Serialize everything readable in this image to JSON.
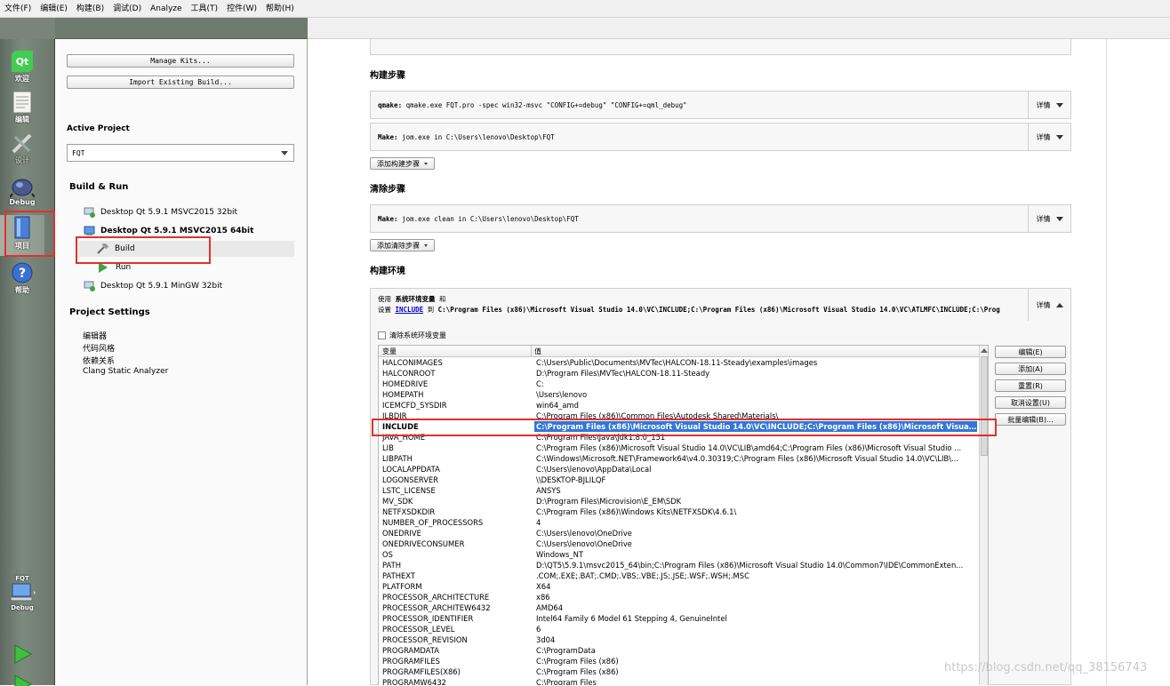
{
  "menu": [
    "文件(F)",
    "编辑(E)",
    "构建(B)",
    "调试(D)",
    "Analyze",
    "工具(T)",
    "控件(W)",
    "帮助(H)"
  ],
  "modes": [
    {
      "name": "welcome",
      "label": "欢迎",
      "icon": "qt-logo-icon"
    },
    {
      "name": "edit",
      "label": "编辑",
      "icon": "document-icon"
    },
    {
      "name": "design",
      "label": "设计",
      "icon": "pen-ruler-icon"
    },
    {
      "name": "debug",
      "label": "Debug",
      "icon": "bug-icon"
    },
    {
      "name": "projects",
      "label": "项目",
      "icon": "book-icon"
    },
    {
      "name": "help",
      "label": "帮助",
      "icon": "help-icon"
    }
  ],
  "target": {
    "project": "FQT",
    "config": "Debug"
  },
  "left": {
    "manage_kits": "Manage Kits...",
    "import_build": "Import Existing Build...",
    "active_project_title": "Active Project",
    "active_project_value": "FQT",
    "build_run_title": "Build & Run",
    "kits": [
      {
        "label": "Desktop Qt 5.9.1 MSVC2015 32bit"
      },
      {
        "label": "Desktop Qt 5.9.1 MSVC2015 64bit"
      },
      {
        "label": "Build"
      },
      {
        "label": "Run"
      },
      {
        "label": "Desktop Qt 5.9.1 MinGW 32bit"
      }
    ],
    "settings_title": "Project Settings",
    "settings": [
      "编辑器",
      "代码风格",
      "依赖关系",
      "Clang Static Analyzer"
    ]
  },
  "main": {
    "build_steps_title": "构建步骤",
    "qmake_label": "qmake:",
    "qmake_cmd": "qmake.exe FQT.pro -spec win32-msvc \"CONFIG+=debug\" \"CONFIG+=qml_debug\"",
    "make_label": "Make:",
    "make_cmd": "jom.exe in C:\\Users\\lenovo\\Desktop\\FQT",
    "details": "详情",
    "add_build_step": "添加构建步骤",
    "clean_steps_title": "清除步骤",
    "clean_cmd": "jom.exe clean in C:\\Users\\lenovo\\Desktop\\FQT",
    "add_clean_step": "添加清除步骤",
    "env_title": "构建环境",
    "env_line1_a": "使用",
    "env_line1_b": "系统环境变量",
    "env_line1_c": "和",
    "env_line2_a": "设置",
    "env_line2_var": "INCLUDE",
    "env_line2_b": "到",
    "env_line2_val": "C:\\Program Files (x86)\\Microsoft Visual Studio 14.0\\VC\\INCLUDE;C:\\Program Files (x86)\\Microsoft Visual Studio 14.0\\VC\\ATLMFC\\INCLUDE;C:\\Prog",
    "clear_sys_env": "清除系统环境变量",
    "col_var": "变量",
    "col_val": "值",
    "buttons": [
      "编辑(E)",
      "添加(A)",
      "重置(R)",
      "取消设置(U)",
      "批量编辑(B)..."
    ],
    "rows": [
      {
        "k": "HALCONIMAGES",
        "v": "C:\\Users\\Public\\Documents\\MVTec\\HALCON-18.11-Steady\\examples\\images"
      },
      {
        "k": "HALCONROOT",
        "v": "D:\\Program Files\\MVTec\\HALCON-18.11-Steady"
      },
      {
        "k": "HOMEDRIVE",
        "v": "C:"
      },
      {
        "k": "HOMEPATH",
        "v": "\\Users\\lenovo"
      },
      {
        "k": "ICEMCFD_SYSDIR",
        "v": "win64_amd"
      },
      {
        "k": "ILBDIR",
        "v": "C:\\Program Files (x86)\\Common Files\\Autodesk Shared\\Materials\\"
      },
      {
        "k": "INCLUDE",
        "v": "C:\\Program Files (x86)\\Microsoft Visual Studio 14.0\\VC\\INCLUDE;C:\\Program Files (x86)\\Microsoft Visual St..."
      },
      {
        "k": "JAVA_HOME",
        "v": "C:\\Program Files\\Java\\jdk1.8.0_151"
      },
      {
        "k": "LIB",
        "v": "C:\\Program Files (x86)\\Microsoft Visual Studio 14.0\\VC\\LIB\\amd64;C:\\Program Files (x86)\\Microsoft Visual Studio ..."
      },
      {
        "k": "LIBPATH",
        "v": "C:\\Windows\\Microsoft.NET\\Framework64\\v4.0.30319;C:\\Program Files (x86)\\Microsoft Visual Studio 14.0\\VC\\LIB\\..."
      },
      {
        "k": "LOCALAPPDATA",
        "v": "C:\\Users\\lenovo\\AppData\\Local"
      },
      {
        "k": "LOGONSERVER",
        "v": "\\\\DESKTOP-BJLILQF"
      },
      {
        "k": "LSTC_LICENSE",
        "v": "ANSYS"
      },
      {
        "k": "MV_SDK",
        "v": "D:\\Program Files\\Microvision\\E_EM\\SDK"
      },
      {
        "k": "NETFXSDKDIR",
        "v": "C:\\Program Files (x86)\\Windows Kits\\NETFXSDK\\4.6.1\\"
      },
      {
        "k": "NUMBER_OF_PROCESSORS",
        "v": "4"
      },
      {
        "k": "ONEDRIVE",
        "v": "C:\\Users\\lenovo\\OneDrive"
      },
      {
        "k": "ONEDRIVECONSUMER",
        "v": "C:\\Users\\lenovo\\OneDrive"
      },
      {
        "k": "OS",
        "v": "Windows_NT"
      },
      {
        "k": "PATH",
        "v": "D:\\QT5\\5.9.1\\msvc2015_64\\bin;C:\\Program Files (x86)\\Microsoft Visual Studio 14.0\\Common7\\IDE\\CommonExten..."
      },
      {
        "k": "PATHEXT",
        "v": ".COM;.EXE;.BAT;.CMD;.VBS;.VBE;.JS;.JSE;.WSF;.WSH;.MSC"
      },
      {
        "k": "PLATFORM",
        "v": "X64"
      },
      {
        "k": "PROCESSOR_ARCHITECTURE",
        "v": "x86"
      },
      {
        "k": "PROCESSOR_ARCHITEW6432",
        "v": "AMD64"
      },
      {
        "k": "PROCESSOR_IDENTIFIER",
        "v": "Intel64 Family 6 Model 61 Stepping 4, GenuineIntel"
      },
      {
        "k": "PROCESSOR_LEVEL",
        "v": "6"
      },
      {
        "k": "PROCESSOR_REVISION",
        "v": "3d04"
      },
      {
        "k": "PROGRAMDATA",
        "v": "C:\\ProgramData"
      },
      {
        "k": "PROGRAMFILES",
        "v": "C:\\Program Files (x86)"
      },
      {
        "k": "PROGRAMFILES(X86)",
        "v": "C:\\Program Files (x86)"
      },
      {
        "k": "PROGRAMW6432",
        "v": "C:\\Program Files"
      }
    ]
  },
  "watermark": "https://blog.csdn.net/qq_38156743",
  "colors": {
    "highlight": "#e03030",
    "selection": "#3377d6",
    "link": "#0000cc"
  }
}
